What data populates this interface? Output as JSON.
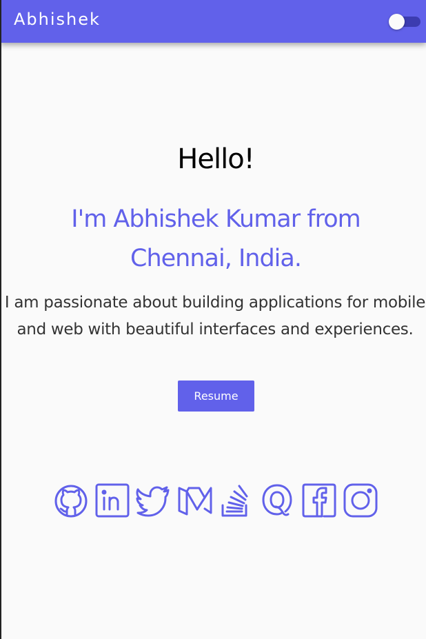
{
  "app": {
    "title": "Abhishek",
    "accent_color": "#6161ea",
    "theme_toggle": {
      "state": "off",
      "icon": "toggle-switch-icon"
    }
  },
  "hero": {
    "greeting": "Hello!",
    "headline": "I'm Abhishek Kumar from Chennai, India.",
    "bio": "I am passionate about building applications for mobile and web with beautiful interfaces and experiences.",
    "resume_label": "Resume"
  },
  "social": [
    {
      "name": "github",
      "icon": "github-icon"
    },
    {
      "name": "linkedin",
      "icon": "linkedin-icon"
    },
    {
      "name": "twitter",
      "icon": "twitter-icon"
    },
    {
      "name": "medium",
      "icon": "medium-icon"
    },
    {
      "name": "stackoverflow",
      "icon": "stackoverflow-icon"
    },
    {
      "name": "quora",
      "icon": "quora-icon"
    },
    {
      "name": "facebook",
      "icon": "facebook-icon"
    },
    {
      "name": "instagram",
      "icon": "instagram-icon"
    }
  ]
}
